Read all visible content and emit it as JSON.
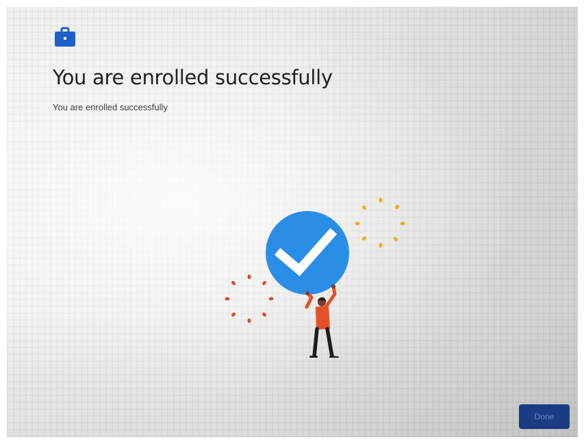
{
  "header": {
    "icon": "briefcase-icon",
    "title": "You are enrolled successfully",
    "subtitle": "You are enrolled successfully"
  },
  "illustration": {
    "icon": "checkmark-icon",
    "figure": "person-holding-checkmark",
    "colors": {
      "circle": "#2b8ee6",
      "shirt": "#e5502a",
      "confetti_gold": "#e8b12b",
      "confetti_red": "#d94a35"
    }
  },
  "footer": {
    "done_label": "Done",
    "done_color": "#1a3f8c"
  }
}
